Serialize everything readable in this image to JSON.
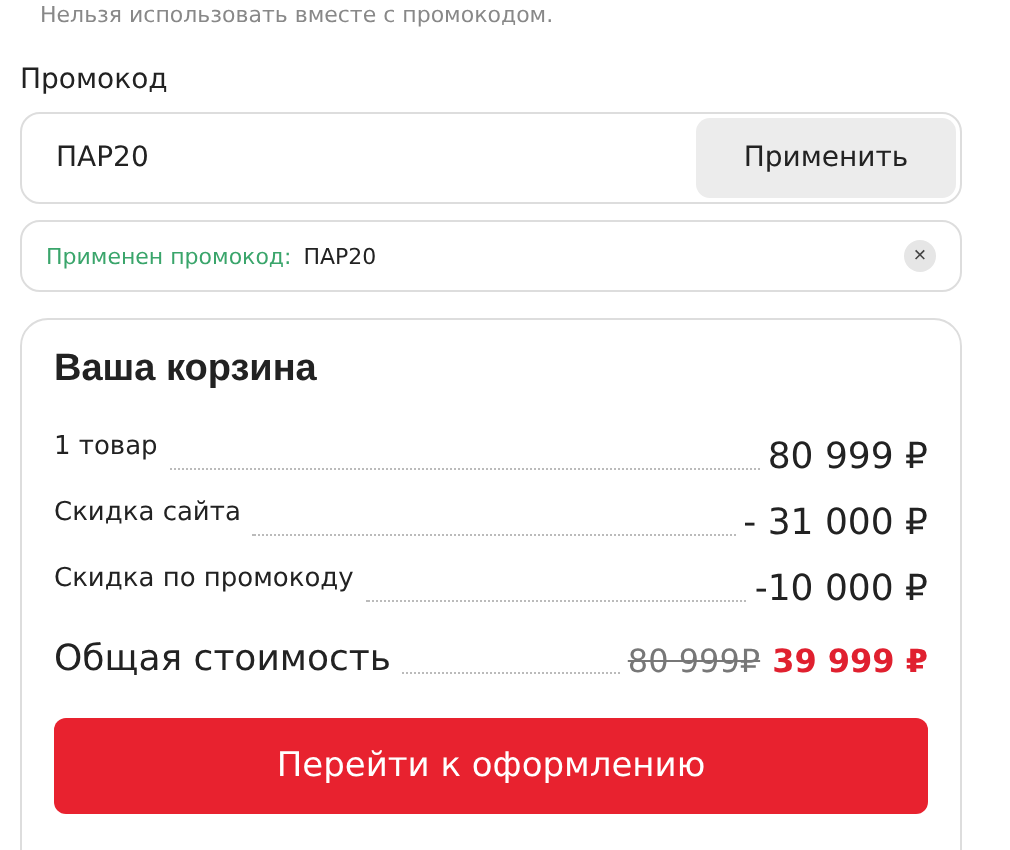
{
  "note": "Нельзя использовать вместе с промокодом.",
  "promo": {
    "label": "Промокод",
    "value": "ПАР20",
    "apply_button": "Применить"
  },
  "applied": {
    "label": "Применен промокод:",
    "code": "ПАР20",
    "remove": "×"
  },
  "cart": {
    "title": "Ваша корзина",
    "rows": [
      {
        "label": "1 товар",
        "value": "80 999 ₽"
      },
      {
        "label": "Скидка сайта",
        "value": "- 31 000 ₽"
      },
      {
        "label": "Скидка по промокоду",
        "value": "-10 000 ₽"
      }
    ],
    "total": {
      "label": "Общая стоимость",
      "old_price": "80 999₽",
      "price": "39 999 ₽"
    },
    "checkout_button": "Перейти к оформлению"
  }
}
